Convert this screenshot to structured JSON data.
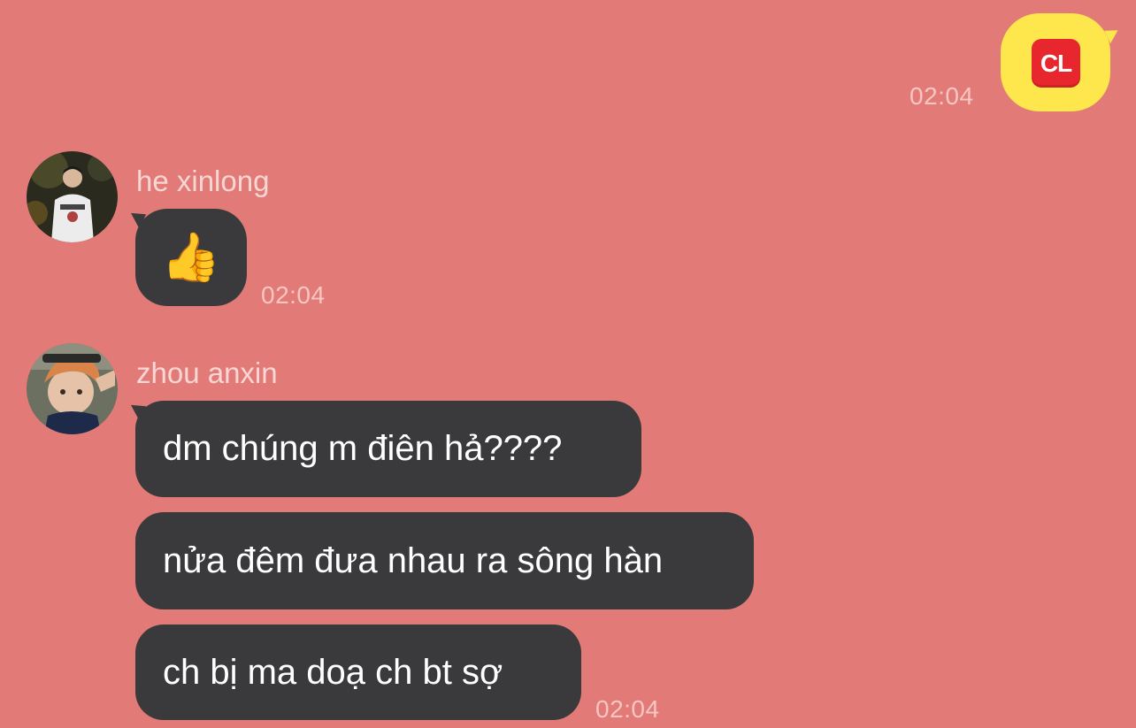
{
  "chat": {
    "outgoing": {
      "sticker": "CL",
      "time": "02:04"
    },
    "groups": [
      {
        "sender": "he xinlong",
        "messages": [
          {
            "text": "👍"
          }
        ],
        "time": "02:04"
      },
      {
        "sender": "zhou anxin",
        "messages": [
          {
            "text": "dm chúng m điên hả????"
          },
          {
            "text": "nửa đêm đưa nhau ra sông hàn"
          },
          {
            "text": "ch bị ma doạ ch bt sợ"
          }
        ],
        "time": "02:04"
      }
    ]
  },
  "colors": {
    "background": "#e27b78",
    "outgoing_bubble": "#fde74c",
    "incoming_bubble": "#3a3a3c",
    "cl_icon": "#e8262d"
  }
}
